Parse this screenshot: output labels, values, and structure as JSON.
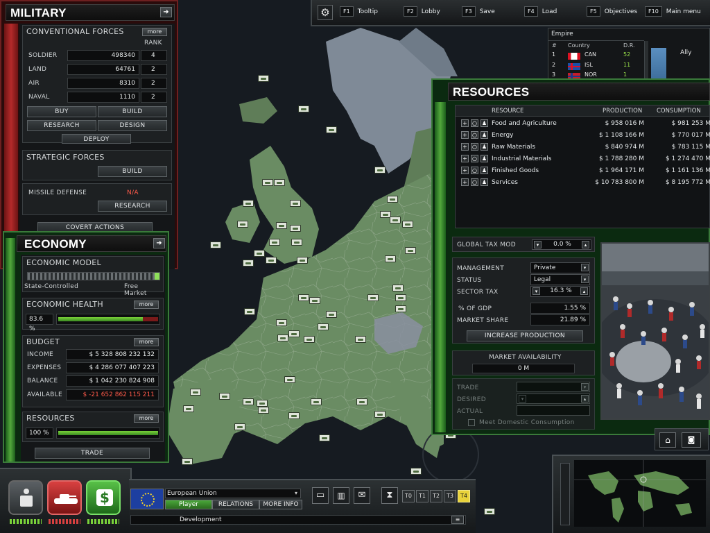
{
  "topbar": {
    "keys": [
      {
        "key": "F1",
        "label": "Tooltip"
      },
      {
        "key": "F2",
        "label": "Lobby"
      },
      {
        "key": "F3",
        "label": "Save"
      },
      {
        "key": "F4",
        "label": "Load"
      },
      {
        "key": "F5",
        "label": "Objectives"
      },
      {
        "key": "F10",
        "label": "Main menu"
      }
    ]
  },
  "military": {
    "title": "MILITARY",
    "conventional_title": "CONVENTIONAL FORCES",
    "more": "more",
    "rank_header": "RANK",
    "forces": [
      {
        "label": "SOLDIER",
        "value": "498340",
        "rank": "4"
      },
      {
        "label": "LAND",
        "value": "64761",
        "rank": "2"
      },
      {
        "label": "AIR",
        "value": "8310",
        "rank": "2"
      },
      {
        "label": "NAVAL",
        "value": "1110",
        "rank": "2"
      }
    ],
    "buttons": {
      "buy": "BUY",
      "build": "BUILD",
      "research": "RESEARCH",
      "design": "DESIGN",
      "deploy": "DEPLOY"
    },
    "strategic_title": "STRATEGIC FORCES",
    "strategic_build": "BUILD",
    "missile_label": "MISSILE DEFENSE",
    "missile_value": "N/A",
    "missile_research": "RESEARCH",
    "covert": "COVERT ACTIONS"
  },
  "economy": {
    "title": "ECONOMY",
    "model_title": "ECONOMIC MODEL",
    "model_left": "State-Controlled",
    "model_right": "Free Market",
    "health_title": "ECONOMIC HEALTH",
    "health_value": "83.6 %",
    "health_fraction": 0.836,
    "more": "more",
    "budget_title": "BUDGET",
    "budget": [
      {
        "label": "INCOME",
        "value": "$ 5 328 808 232 132"
      },
      {
        "label": "EXPENSES",
        "value": "$ 4 286 077 407 223"
      },
      {
        "label": "BALANCE",
        "value": "$ 1 042 230 824 908"
      },
      {
        "label": "AVAILABLE",
        "value": "$ -21 652 862 115 211"
      }
    ],
    "resources_title": "RESOURCES",
    "resources_value": "100 %",
    "trade": "TRADE"
  },
  "empire": {
    "title": "Empire",
    "headers": {
      "num": "#",
      "country": "Country",
      "dr": "D.R."
    },
    "rows": [
      {
        "num": "1",
        "country": "CAN",
        "dr": "52"
      },
      {
        "num": "2",
        "country": "ISL",
        "dr": "11"
      },
      {
        "num": "3",
        "country": "NOR",
        "dr": "1"
      }
    ],
    "side_label": "Ally"
  },
  "resources": {
    "title": "RESOURCES",
    "headers": {
      "resource": "RESOURCE",
      "production": "PRODUCTION",
      "consumption": "CONSUMPTION"
    },
    "rows": [
      {
        "name": "Food and Agriculture",
        "production": "$ 958 016 M",
        "consumption": "$ 981 253 M"
      },
      {
        "name": "Energy",
        "production": "$ 1 108 166 M",
        "consumption": "$ 770 017 M"
      },
      {
        "name": "Raw Materials",
        "production": "$ 840 974 M",
        "consumption": "$ 783 115 M"
      },
      {
        "name": "Industrial Materials",
        "production": "$ 1 788 280 M",
        "consumption": "$ 1 274 470 M"
      },
      {
        "name": "Finished Goods",
        "production": "$ 1 964 171 M",
        "consumption": "$ 1 161 136 M"
      },
      {
        "name": "Services",
        "production": "$ 10 783 800 M",
        "consumption": "$ 8 195 772 M"
      }
    ],
    "global_tax_label": "GLOBAL TAX MOD",
    "global_tax_value": "0.0 %",
    "management_label": "MANAGEMENT",
    "management_value": "Private",
    "status_label": "STATUS",
    "status_value": "Legal",
    "sector_tax_label": "SECTOR TAX",
    "sector_tax_value": "16.3 %",
    "gdp_label": "% OF GDP",
    "gdp_value": "1.55 %",
    "market_share_label": "MARKET SHARE",
    "market_share_value": "21.89 %",
    "increase": "INCREASE PRODUCTION",
    "availability_label": "MARKET AVAILABILITY",
    "availability_value": "0 M",
    "trade_label": "TRADE",
    "desired_label": "DESIRED",
    "actual_label": "ACTUAL",
    "meet_label": "Meet Domestic Consumption"
  },
  "bottom": {
    "country": "European Union",
    "player": "Player",
    "relations": "RELATIONS",
    "more_info": "MORE INFO",
    "status": "Development",
    "tiers": [
      "T0",
      "T1",
      "T2",
      "T3",
      "T4"
    ]
  },
  "colors": {
    "military_accent": "#b52a2a",
    "economy_accent": "#53a83c",
    "available_negative": "#ff5a4a",
    "dr_positive": "#9be34a"
  }
}
